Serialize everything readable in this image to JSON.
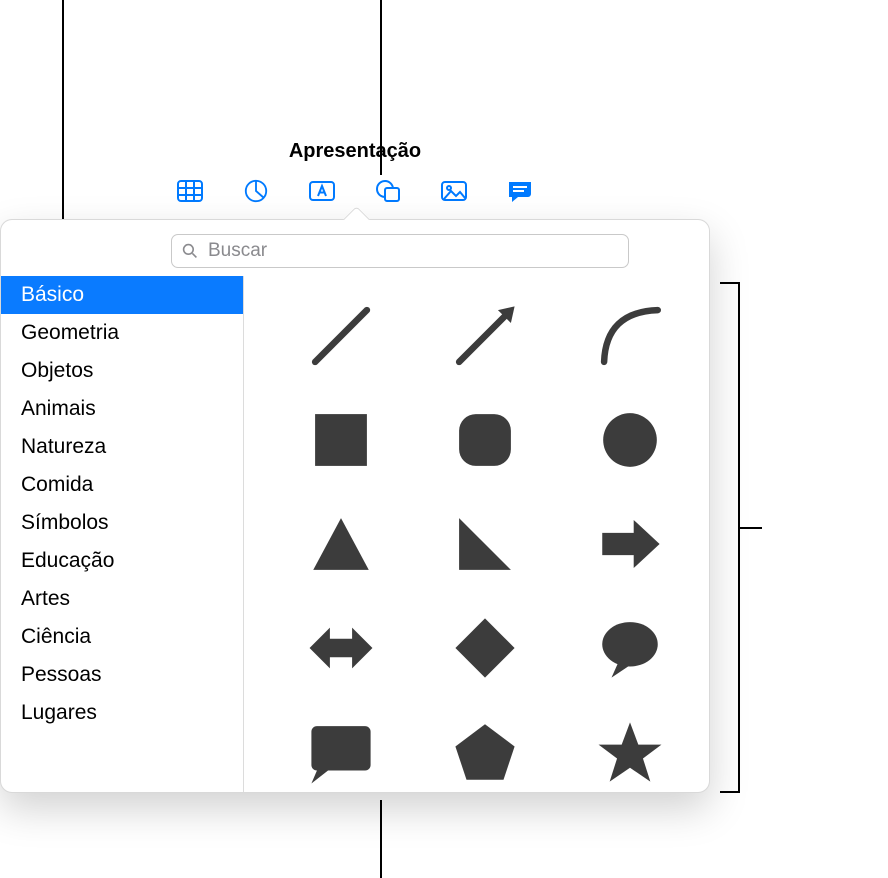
{
  "window": {
    "title": "Apresentação"
  },
  "toolbar": {
    "items": [
      "table",
      "chart",
      "text",
      "shape",
      "media",
      "comment"
    ]
  },
  "search": {
    "placeholder": "Buscar"
  },
  "sidebar": {
    "selected_index": 0,
    "items": [
      {
        "label": "Básico"
      },
      {
        "label": "Geometria"
      },
      {
        "label": "Objetos"
      },
      {
        "label": "Animais"
      },
      {
        "label": "Natureza"
      },
      {
        "label": "Comida"
      },
      {
        "label": "Símbolos"
      },
      {
        "label": "Educação"
      },
      {
        "label": "Artes"
      },
      {
        "label": "Ciência"
      },
      {
        "label": "Pessoas"
      },
      {
        "label": "Lugares"
      }
    ]
  },
  "shapes": {
    "items": [
      "line",
      "arrow-line",
      "curve",
      "square",
      "rounded-square",
      "circle",
      "triangle",
      "right-triangle",
      "arrow-right",
      "arrow-left-right",
      "diamond",
      "speech-bubble",
      "callout-square",
      "pentagon",
      "star"
    ]
  },
  "colors": {
    "accent": "#007aff",
    "shape": "#3c3c3c"
  }
}
